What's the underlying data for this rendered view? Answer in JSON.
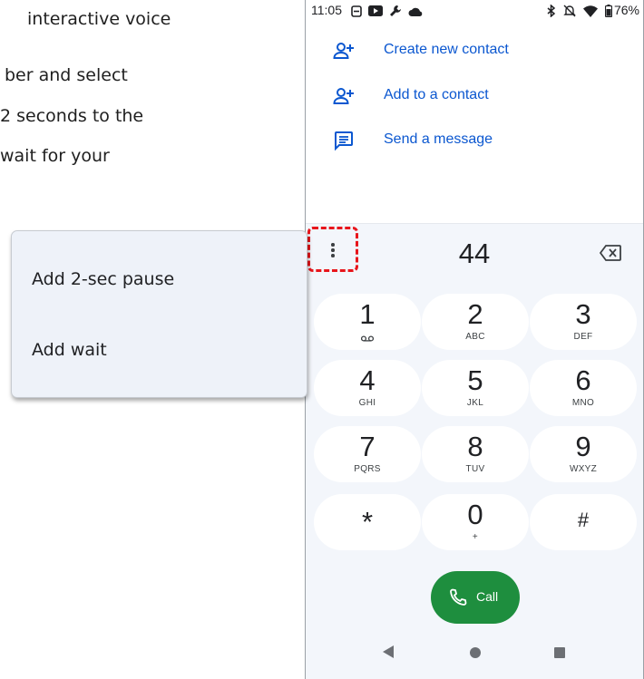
{
  "background_text": [
    "interactive voice",
    "ber and select",
    "2 seconds to the",
    " wait for your"
  ],
  "status_bar": {
    "time": "11:05",
    "battery": "76%",
    "left_icons": [
      "notification-icon",
      "youtube-icon",
      "wrench-icon",
      "cloud-icon"
    ],
    "right_icons": [
      "bluetooth-icon",
      "mute-icon",
      "wifi-icon",
      "battery-icon"
    ]
  },
  "contact_actions": [
    {
      "label": "Create new contact",
      "icon": "person-add-icon"
    },
    {
      "label": "Add to a contact",
      "icon": "person-add-icon"
    },
    {
      "label": "Send a message",
      "icon": "message-icon"
    }
  ],
  "dialer": {
    "entered_digits": "44",
    "more_options_icon": "more-vert-icon",
    "backspace_icon": "backspace-icon",
    "keys": [
      {
        "num": "1",
        "sub": ""
      },
      {
        "num": "2",
        "sub": "ABC"
      },
      {
        "num": "3",
        "sub": "DEF"
      },
      {
        "num": "4",
        "sub": "GHI"
      },
      {
        "num": "5",
        "sub": "JKL"
      },
      {
        "num": "6",
        "sub": "MNO"
      },
      {
        "num": "7",
        "sub": "PQRS"
      },
      {
        "num": "8",
        "sub": "TUV"
      },
      {
        "num": "9",
        "sub": "WXYZ"
      },
      {
        "num": "*",
        "sub": ""
      },
      {
        "num": "0",
        "sub": "+"
      },
      {
        "num": "#",
        "sub": ""
      }
    ],
    "call_label": "Call"
  },
  "more_menu": {
    "items": [
      "Add 2-sec pause",
      "Add wait"
    ]
  },
  "colors": {
    "accent_blue": "#0b57d0",
    "call_green": "#1e8e3e",
    "highlight_red": "#e8151b",
    "dialer_bg": "#f3f6fb",
    "menu_bg": "#eef2f9"
  }
}
